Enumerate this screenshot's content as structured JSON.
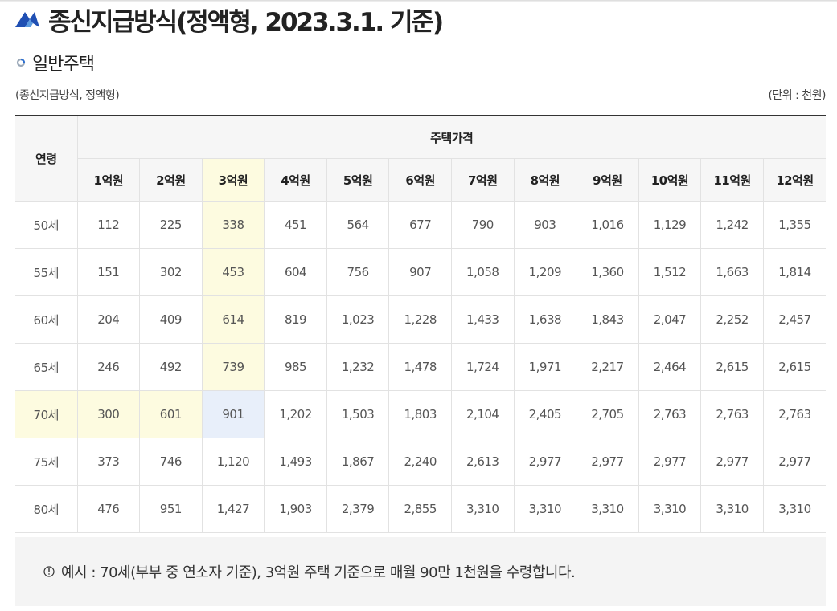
{
  "page": {
    "title": "종신지급방식(정액형, 2023.3.1. 기준)",
    "subtitle": "일반주택",
    "caption_left": "(종신지급방식, 정액형)",
    "caption_right": "(단위 : 천원)"
  },
  "table": {
    "age_header": "연령",
    "price_header": "주택가격",
    "price_columns": [
      "1억원",
      "2억원",
      "3억원",
      "4억원",
      "5억원",
      "6억원",
      "7억원",
      "8억원",
      "9억원",
      "10억원",
      "11억원",
      "12억원"
    ],
    "rows": [
      {
        "age": "50세",
        "values": [
          "112",
          "225",
          "338",
          "451",
          "564",
          "677",
          "790",
          "903",
          "1,016",
          "1,129",
          "1,242",
          "1,355"
        ]
      },
      {
        "age": "55세",
        "values": [
          "151",
          "302",
          "453",
          "604",
          "756",
          "907",
          "1,058",
          "1,209",
          "1,360",
          "1,512",
          "1,663",
          "1,814"
        ]
      },
      {
        "age": "60세",
        "values": [
          "204",
          "409",
          "614",
          "819",
          "1,023",
          "1,228",
          "1,433",
          "1,638",
          "1,843",
          "2,047",
          "2,252",
          "2,457"
        ]
      },
      {
        "age": "65세",
        "values": [
          "246",
          "492",
          "739",
          "985",
          "1,232",
          "1,478",
          "1,724",
          "1,971",
          "2,217",
          "2,464",
          "2,615",
          "2,615"
        ]
      },
      {
        "age": "70세",
        "values": [
          "300",
          "601",
          "901",
          "1,202",
          "1,503",
          "1,803",
          "2,104",
          "2,405",
          "2,705",
          "2,763",
          "2,763",
          "2,763"
        ]
      },
      {
        "age": "75세",
        "values": [
          "373",
          "746",
          "1,120",
          "1,493",
          "1,867",
          "2,240",
          "2,613",
          "2,977",
          "2,977",
          "2,977",
          "2,977",
          "2,977"
        ]
      },
      {
        "age": "80세",
        "values": [
          "476",
          "951",
          "1,427",
          "1,903",
          "2,379",
          "2,855",
          "3,310",
          "3,310",
          "3,310",
          "3,310",
          "3,310",
          "3,310"
        ]
      }
    ],
    "highlight_column_index": 2,
    "highlight_row_index": 4,
    "colors": {
      "highlight_yellow": "#fdfbe0",
      "highlight_blue": "#e8effa",
      "header_bg": "#f6f6f6"
    }
  },
  "note": {
    "icon": "exclamation-circle-icon",
    "text": "예시 : 70세(부부 중 연소자 기준), 3억원 주택 기준으로 매월 90만 1천원을 수령합니다."
  },
  "icons": {
    "title": "mountain-logo-icon",
    "subtitle": "ring-bullet-icon"
  }
}
